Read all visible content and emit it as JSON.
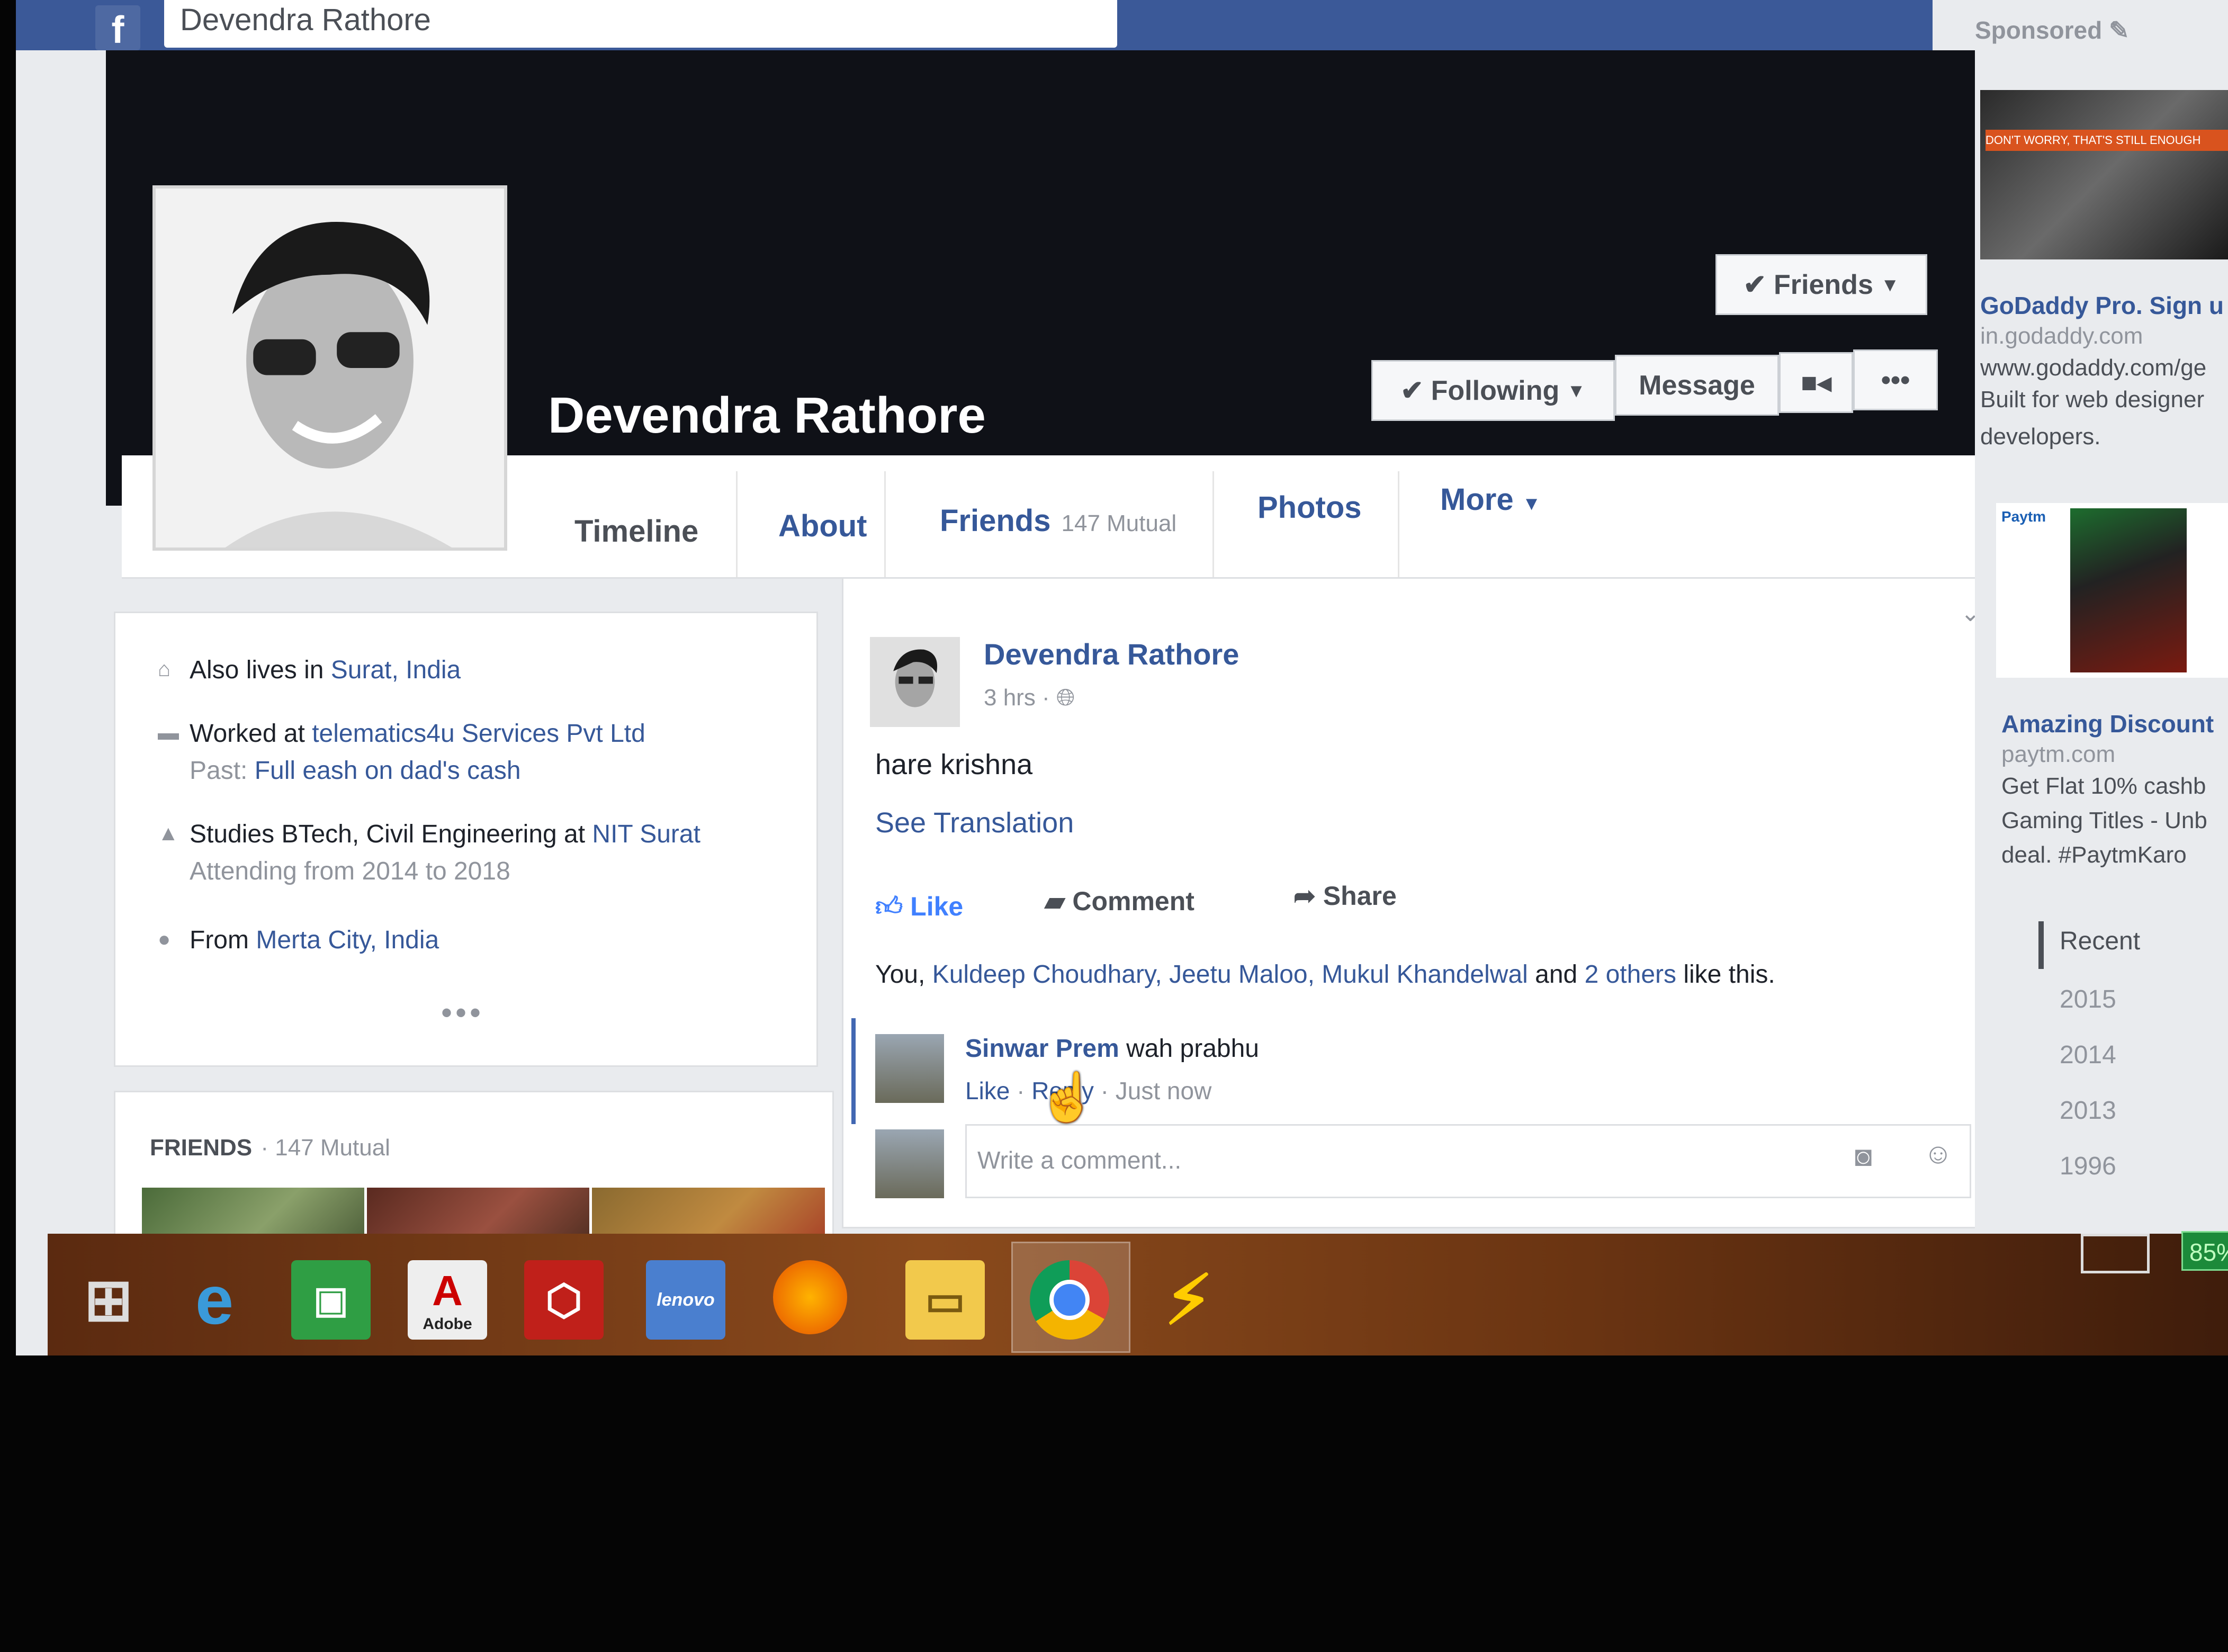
{
  "topbar": {
    "search_value": "Devendra Rathore"
  },
  "profile": {
    "name": "Devendra Rathore",
    "buttons": {
      "friends": "Friends",
      "following": "Following",
      "message": "Message"
    }
  },
  "nav": {
    "tabs": [
      {
        "label": "Timeline"
      },
      {
        "label": "About"
      },
      {
        "label": "Friends",
        "extra": "147 Mutual"
      },
      {
        "label": "Photos"
      },
      {
        "label": "More"
      }
    ]
  },
  "intro": {
    "lives_prefix": "Also lives in ",
    "lives_link": "Surat, India",
    "work_prefix": "Worked at ",
    "work_link": "telematics4u Services Pvt Ltd",
    "past_prefix": "Past: ",
    "past_link": "Full eash on dad's cash",
    "study_prefix": "Studies BTech, Civil Engineering at ",
    "study_link": "NIT Surat",
    "study_sub": "Attending from 2014 to 2018",
    "from_prefix": "From ",
    "from_link": "Merta City, India"
  },
  "friends_section": {
    "title": "FRIENDS",
    "mutual": "· 147 Mutual"
  },
  "post": {
    "author": "Devendra Rathore",
    "time": "3 hrs ·",
    "text": "hare krishna",
    "see_translation": "See Translation",
    "actions": {
      "like": "Like",
      "comment": "Comment",
      "share": "Share"
    },
    "likes": {
      "you": "You, ",
      "names": "Kuldeep Choudhary, Jeetu Maloo, Mukul Khandelwal",
      "and": " and ",
      "others": "2 others",
      "suffix": " like this."
    },
    "comment": {
      "name": "Sinwar Prem",
      "text": " wah prabhu",
      "like": "Like",
      "reply": "Reply",
      "time": "Just now"
    },
    "comment_placeholder": "Write a comment..."
  },
  "sidebar": {
    "sponsored": "Sponsored",
    "ad1": {
      "banner": "DON'T WORRY, THAT'S STILL ENOUGH",
      "title": "GoDaddy Pro. Sign u",
      "domain": "in.godaddy.com",
      "line1": "www.godaddy.com/ge",
      "line2": "Built for web designer",
      "line3": "developers."
    },
    "ad2": {
      "brand": "Paytm",
      "title": "Amazing Discount",
      "domain": "paytm.com",
      "line1": "Get Flat 10% cashb",
      "line2": "Gaming Titles - Unb",
      "line3": "deal. #PaytmKaro"
    },
    "years": [
      "Recent",
      "2015",
      "2014",
      "2013",
      "1996"
    ]
  },
  "taskbar": {
    "adobe_label": "Adobe",
    "lenovo_label": "lenovo",
    "battery": "85%"
  },
  "colors": {
    "fb_blue": "#3b5998",
    "link": "#365899",
    "like_blue": "#4080ff"
  }
}
